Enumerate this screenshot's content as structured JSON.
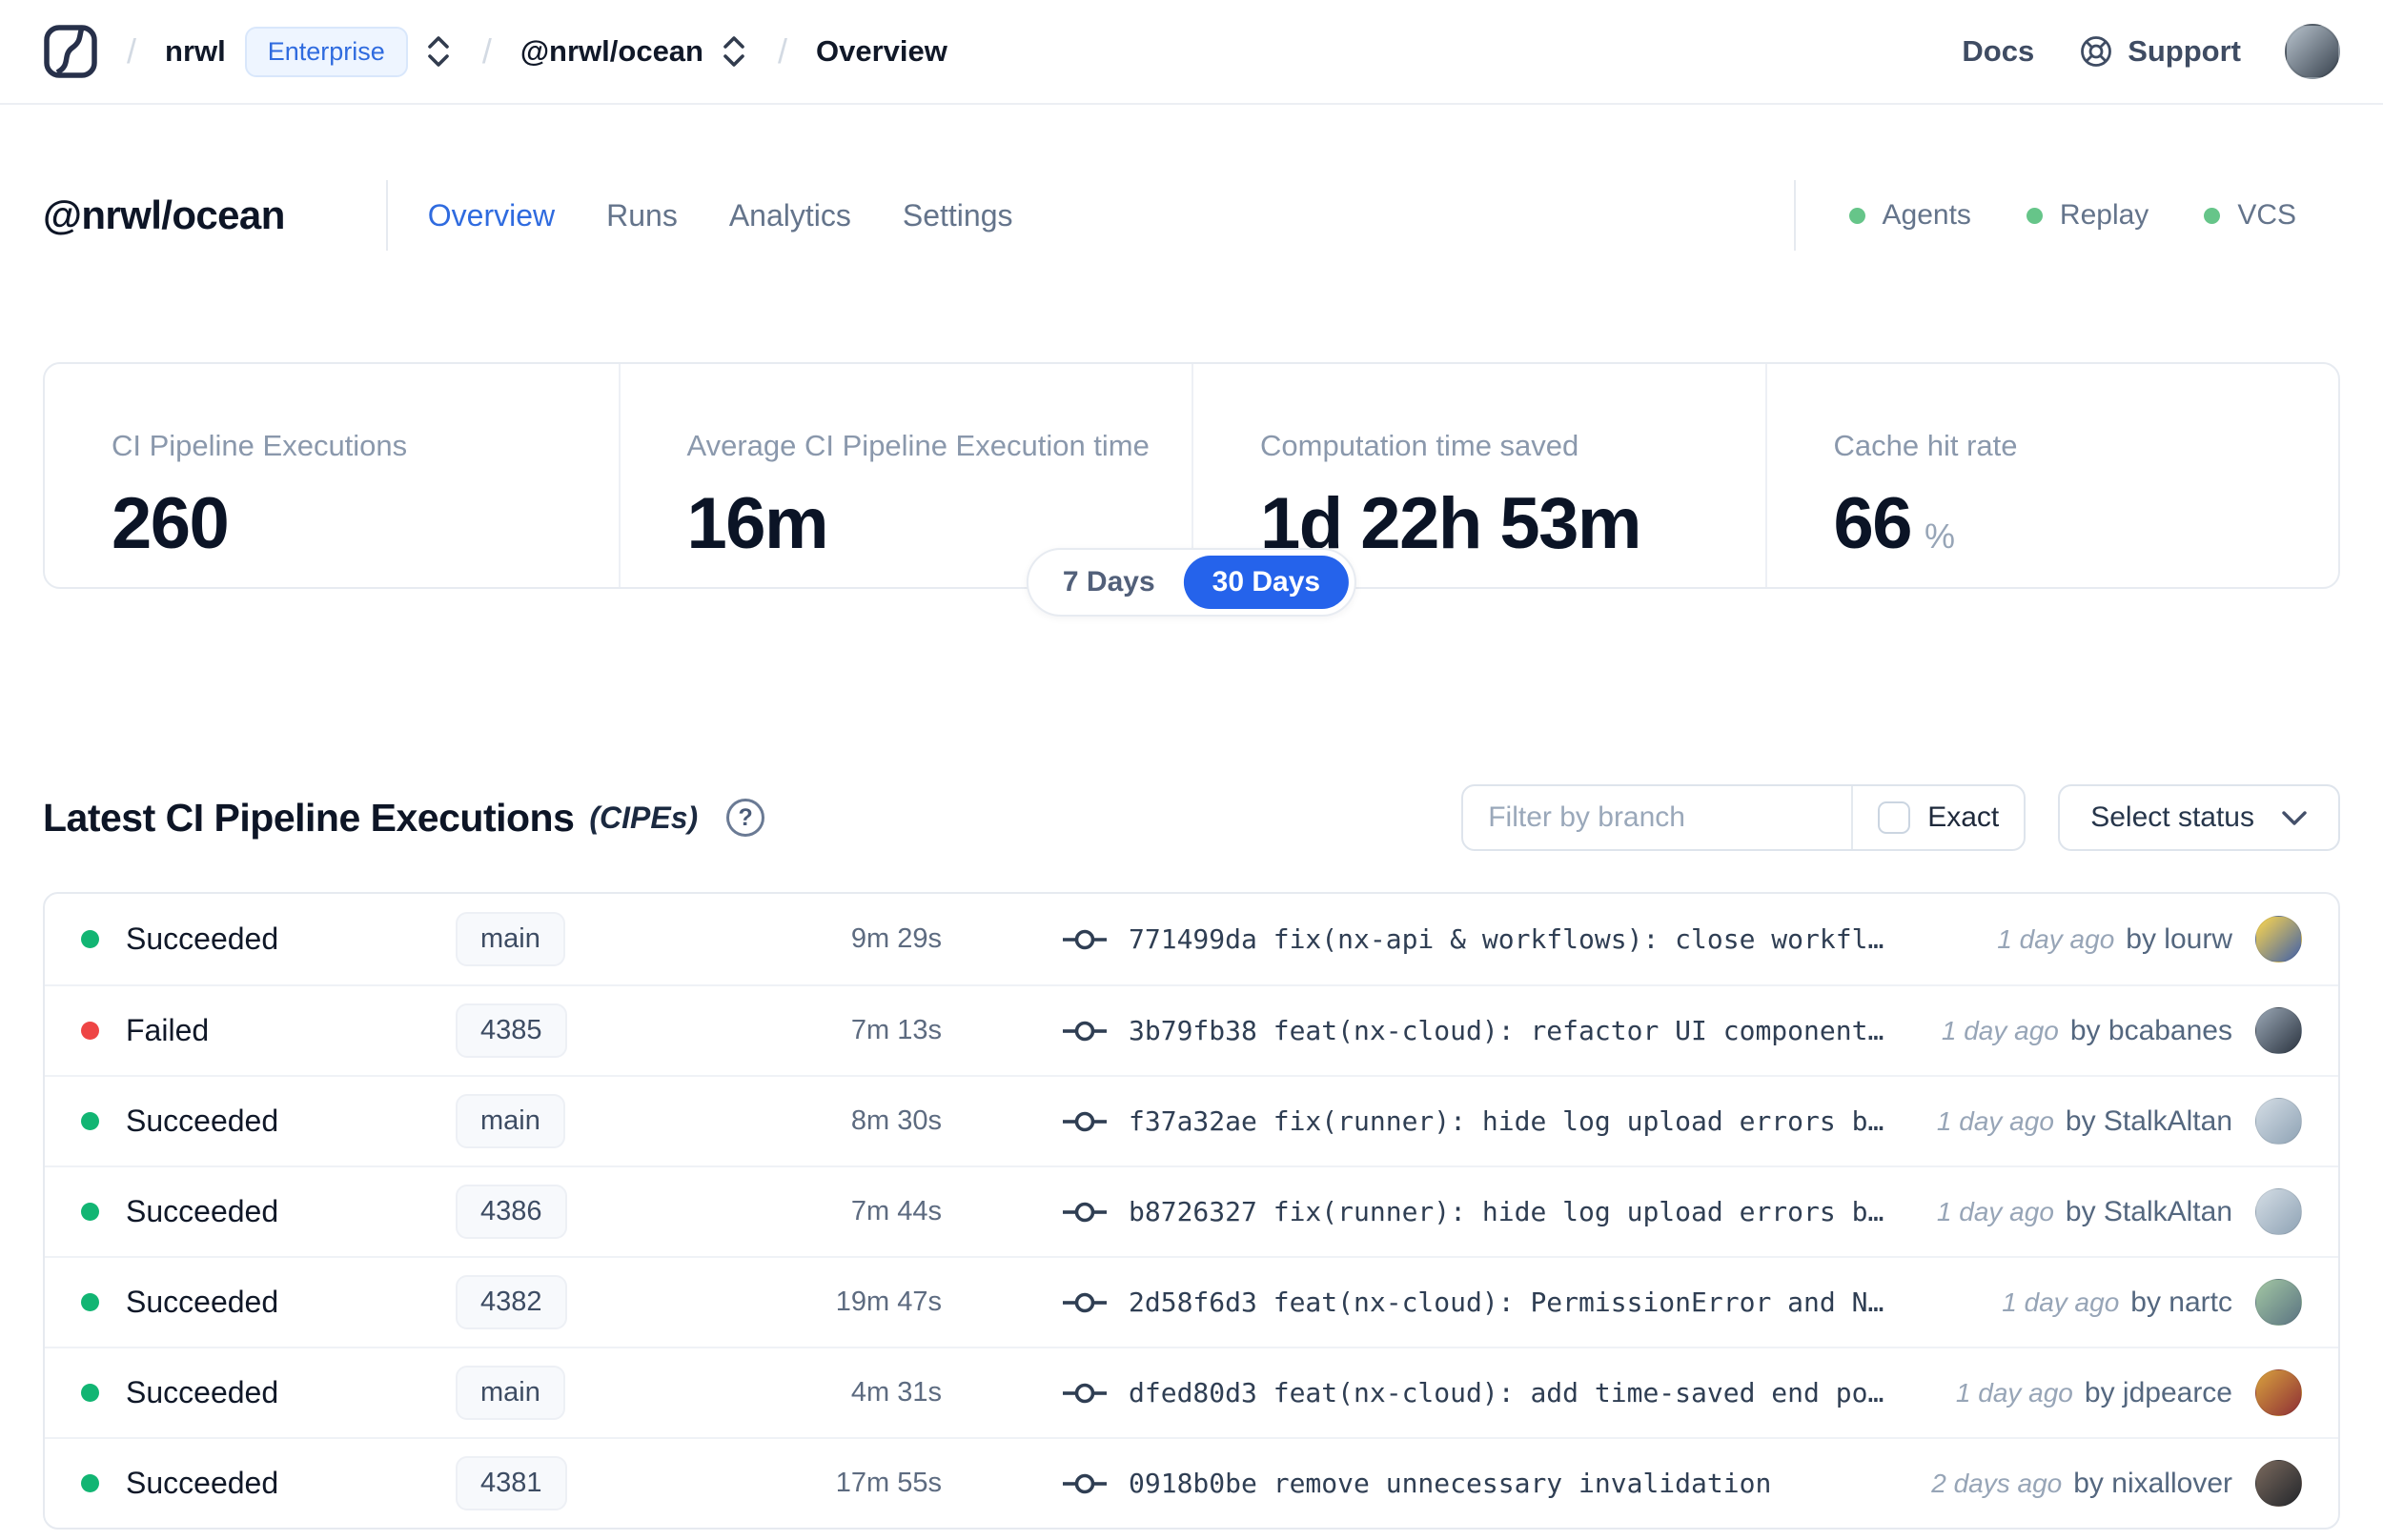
{
  "navbar": {
    "separator": "/",
    "breadcrumb": {
      "org": "nrwl",
      "org_badge": "Enterprise",
      "workspace": "@nrwl/ocean",
      "page": "Overview"
    },
    "links": {
      "docs": "Docs",
      "support": "Support"
    },
    "avatar": [
      "#b9c4ce",
      "#38424e"
    ]
  },
  "header": {
    "title": "@nrwl/ocean",
    "tabs": [
      {
        "label": "Overview",
        "active": true
      },
      {
        "label": "Runs",
        "active": false
      },
      {
        "label": "Analytics",
        "active": false
      },
      {
        "label": "Settings",
        "active": false
      }
    ],
    "statuses": [
      {
        "label": "Agents"
      },
      {
        "label": "Replay"
      },
      {
        "label": "VCS"
      }
    ]
  },
  "stats": {
    "cards": [
      {
        "label": "CI Pipeline Executions",
        "value": "260"
      },
      {
        "label": "Average CI Pipeline Execution time",
        "value": "16m"
      },
      {
        "label": "Computation time saved",
        "value": "1d 22h 53m"
      },
      {
        "label": "Cache hit rate",
        "value": "66",
        "suffix": "%"
      }
    ],
    "range_toggle": {
      "options": [
        "7 Days",
        "30 Days"
      ],
      "selected": "30 Days"
    }
  },
  "table_section": {
    "title": "Latest CI Pipeline Executions",
    "title_suffix": "(CIPEs)",
    "help_glyph": "?",
    "filter": {
      "placeholder": "Filter by branch",
      "exact_label": "Exact",
      "status_label": "Select status"
    },
    "rows": [
      {
        "status": "Succeeded",
        "branch": "main",
        "duration": "9m 29s",
        "commit_hash": "771499da",
        "commit_message": "fix(nx-api & workflows): close workfl…",
        "time": "1 day ago",
        "author": "by lourw",
        "avatar": [
          "#ffd84d",
          "#3f5fa8"
        ]
      },
      {
        "status": "Failed",
        "branch": "4385",
        "duration": "7m 13s",
        "commit_hash": "3b79fb38",
        "commit_message": "feat(nx-cloud): refactor UI component…",
        "time": "1 day ago",
        "author": "by bcabanes",
        "avatar": [
          "#9aa7b5",
          "#2b3440"
        ]
      },
      {
        "status": "Succeeded",
        "branch": "main",
        "duration": "8m 30s",
        "commit_hash": "f37a32ae",
        "commit_message": "fix(runner): hide log upload errors b…",
        "time": "1 day ago",
        "author": "by StalkAltan",
        "avatar": [
          "#d4dde5",
          "#8fa3b5"
        ]
      },
      {
        "status": "Succeeded",
        "branch": "4386",
        "duration": "7m 44s",
        "commit_hash": "b8726327",
        "commit_message": "fix(runner): hide log upload errors b…",
        "time": "1 day ago",
        "author": "by StalkAltan",
        "avatar": [
          "#d4dde5",
          "#8fa3b5"
        ]
      },
      {
        "status": "Succeeded",
        "branch": "4382",
        "duration": "19m 47s",
        "commit_hash": "2d58f6d3",
        "commit_message": "feat(nx-cloud): PermissionError and N…",
        "time": "1 day ago",
        "author": "by nartc",
        "avatar": [
          "#a3c7a4",
          "#5a7381"
        ]
      },
      {
        "status": "Succeeded",
        "branch": "main",
        "duration": "4m 31s",
        "commit_hash": "dfed80d3",
        "commit_message": "feat(nx-cloud): add time-saved end po…",
        "time": "1 day ago",
        "author": "by jdpearce",
        "avatar": [
          "#d8a13e",
          "#8e2f35"
        ]
      },
      {
        "status": "Succeeded",
        "branch": "4381",
        "duration": "17m 55s",
        "commit_hash": "0918b0be",
        "commit_message": "remove unnecessary invalidation",
        "time": "2 days ago",
        "author": "by nixallover",
        "avatar": [
          "#7b6a5e",
          "#23262b"
        ]
      }
    ]
  },
  "colors": {
    "accent_blue": "#2563eb",
    "enterprise_blue": "#2f6bdf",
    "succeeded_dot": "#12b573",
    "failed_dot": "#ee4545",
    "header_status_dot": "#66c589"
  }
}
